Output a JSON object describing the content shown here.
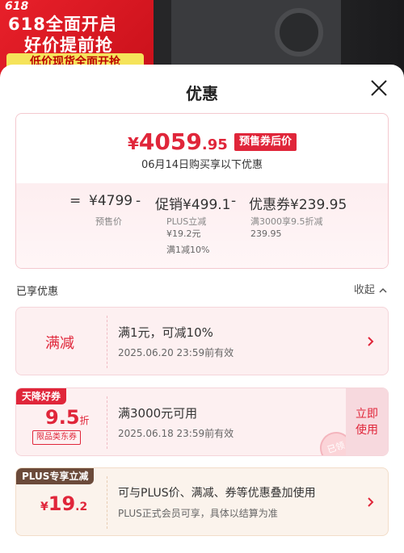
{
  "background": {
    "promo_logo": "618",
    "promo_line1": "618全面开启",
    "promo_line2": "好价提前抢",
    "promo_line3": "低价现货全面开抢"
  },
  "sheet": {
    "title": "优惠",
    "close_icon": "close-icon"
  },
  "price_card": {
    "final_symbol": "¥",
    "final_int": "4059",
    "final_dec": ".95",
    "tag": "预售券后价",
    "subtitle": "06月14日购买享以下优惠",
    "calc": {
      "eq": "=",
      "presale_value": "¥4799",
      "minus1": "-",
      "promo_value": "促销¥499.1",
      "minus2": "-",
      "coupon_value": "优惠券¥239.95",
      "presale_label": "预售价",
      "promo_label_line1": "PLUS立减",
      "promo_label_line2": "¥19.2元",
      "promo_label_line3": "满1减10%",
      "coupon_label_line1": "满3000享9.5折减",
      "coupon_label_line2": "239.95"
    }
  },
  "section": {
    "label": "已享优惠",
    "collapse": "收起"
  },
  "coupons": [
    {
      "left_title": "满减",
      "title": "满1元，可减10%",
      "sub": "2025.06.20 23:59前有效"
    },
    {
      "ribbon": "天降好券",
      "left_big": "9.5",
      "left_unit": "折",
      "left_tag": "限品类东券",
      "title": "满3000元可用",
      "sub": "2025.06.18 23:59前有效",
      "claim_line1": "立即",
      "claim_line2": "使用",
      "stamp": "已领"
    },
    {
      "ribbon": "PLUS专享立减",
      "left_symbol": "¥",
      "left_int": "19",
      "left_dec": ".2",
      "title": "可与PLUS价、满减、券等优惠叠加使用",
      "sub": "PLUS正式会员可享，具体以结算为准"
    }
  ],
  "colors": {
    "accent": "#e0263a",
    "plus_ribbon": "#6b4a3a",
    "coupon_bg": "#fdf0f1",
    "plus_bg": "#fbf3ec"
  }
}
